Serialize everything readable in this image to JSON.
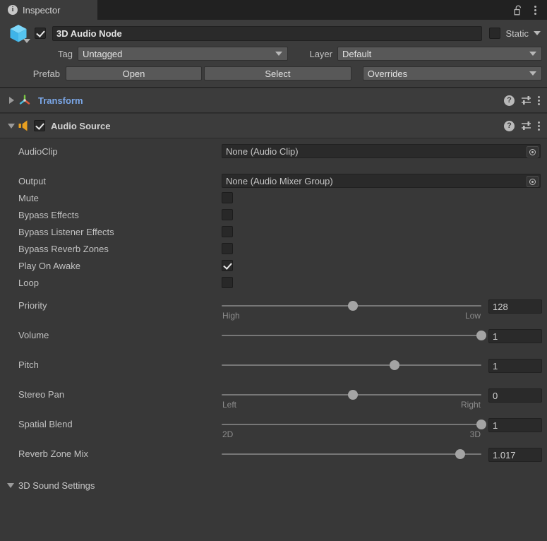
{
  "window": {
    "tab_label": "Inspector",
    "info_icon": "info-icon",
    "lock_icon": "lock-open-icon",
    "menu_icon": "kebab-menu-icon"
  },
  "gameobject": {
    "enabled": true,
    "icon": "cube-icon",
    "name": "3D Audio Node",
    "static_label": "Static",
    "static_checked": false,
    "tag_label": "Tag",
    "tag_value": "Untagged",
    "layer_label": "Layer",
    "layer_value": "Default",
    "prefab_label": "Prefab",
    "prefab_open": "Open",
    "prefab_select": "Select",
    "overrides": "Overrides"
  },
  "components": [
    {
      "name": "Transform",
      "icon": "transform-gizmo-icon",
      "expanded": false,
      "has_enable_toggle": false
    },
    {
      "name": "Audio Source",
      "icon": "audio-speaker-icon",
      "expanded": true,
      "has_enable_toggle": true,
      "enabled": true
    }
  ],
  "component_header_icons": {
    "help": "?",
    "preset": "preset-slider-icon",
    "menu": "kebab-menu-icon"
  },
  "audio_source": {
    "object_fields": [
      {
        "label": "AudioClip",
        "value": "None (Audio Clip)"
      },
      {
        "label": "Output",
        "value": "None (Audio Mixer Group)"
      }
    ],
    "toggles": [
      {
        "label": "Mute",
        "checked": false
      },
      {
        "label": "Bypass Effects",
        "checked": false
      },
      {
        "label": "Bypass Listener Effects",
        "checked": false
      },
      {
        "label": "Bypass Reverb Zones",
        "checked": false
      },
      {
        "label": "Play On Awake",
        "checked": true
      },
      {
        "label": "Loop",
        "checked": false
      }
    ],
    "sliders": [
      {
        "label": "Priority",
        "value": "128",
        "fill": 0.505,
        "min_label": "High",
        "max_label": "Low"
      },
      {
        "label": "Volume",
        "value": "1",
        "fill": 1.0,
        "min_label": "",
        "max_label": ""
      },
      {
        "label": "Pitch",
        "value": "1",
        "fill": 0.665,
        "min_label": "",
        "max_label": ""
      },
      {
        "label": "Stereo Pan",
        "value": "0",
        "fill": 0.505,
        "min_label": "Left",
        "max_label": "Right"
      },
      {
        "label": "Spatial Blend",
        "value": "1",
        "fill": 1.0,
        "min_label": "2D",
        "max_label": "3D"
      },
      {
        "label": "Reverb Zone Mix",
        "value": "1.017",
        "fill": 0.918,
        "min_label": "",
        "max_label": ""
      }
    ],
    "section_3d": "3D Sound Settings"
  },
  "colors": {
    "background": "#383838",
    "header_bg": "#3c3c3c",
    "tabbar_bg": "#212121",
    "field_bg": "#2a2a2a",
    "button_bg": "#585858",
    "accent_link": "#7ba7e8",
    "cube_icon": "#5ec8f5",
    "audio_icon": "#e8a020",
    "slider_track": "#777777",
    "slider_handle": "#a4a4a4"
  }
}
